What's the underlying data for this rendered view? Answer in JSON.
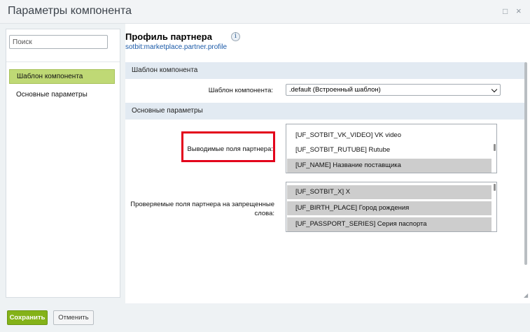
{
  "window": {
    "title": "Параметры компонента",
    "restore_icon": "□",
    "close_icon": "×"
  },
  "sidebar": {
    "search_placeholder": "Поиск",
    "items": [
      {
        "label": "Шаблон компонента",
        "active": true
      },
      {
        "label": "Основные параметры",
        "active": false
      }
    ]
  },
  "main": {
    "title": "Профиль партнера",
    "subtitle": "sotbit:marketplace.partner.profile",
    "info_icon": "i",
    "sections": [
      {
        "label": "Шаблон компонента"
      },
      {
        "label": "Основные параметры"
      }
    ],
    "template_field": {
      "label": "Шаблон компонента:",
      "value": ".default (Встроенный шаблон)"
    },
    "output_fields": {
      "label": "Выводимые поля партнера:",
      "options": [
        {
          "label": "[UF_SOTBIT_VK_VIDEO] VK video",
          "selected": false
        },
        {
          "label": "[UF_SOTBIT_RUTUBE] Rutube",
          "selected": false
        },
        {
          "label": "[UF_NAME] Название поставщика",
          "selected": true
        }
      ]
    },
    "checked_fields": {
      "label_line1": "Проверяемые поля партнера на запрещенные",
      "label_line2": "слова:",
      "options": [
        {
          "label": "[UF_SOTBIT_X] X",
          "selected": true
        },
        {
          "label": "[UF_BIRTH_PLACE] Город рождения",
          "selected": true
        },
        {
          "label": "[UF_PASSPORT_SERIES] Серия паспорта",
          "selected": true
        }
      ]
    }
  },
  "footer": {
    "save_label": "Сохранить",
    "cancel_label": "Отменить"
  },
  "colors": {
    "accent_green": "#84b218",
    "active_item": "#bfd975",
    "section_bg": "#e2eaf2",
    "link_blue": "#1b5aa8",
    "highlight_red": "#e3001b"
  }
}
